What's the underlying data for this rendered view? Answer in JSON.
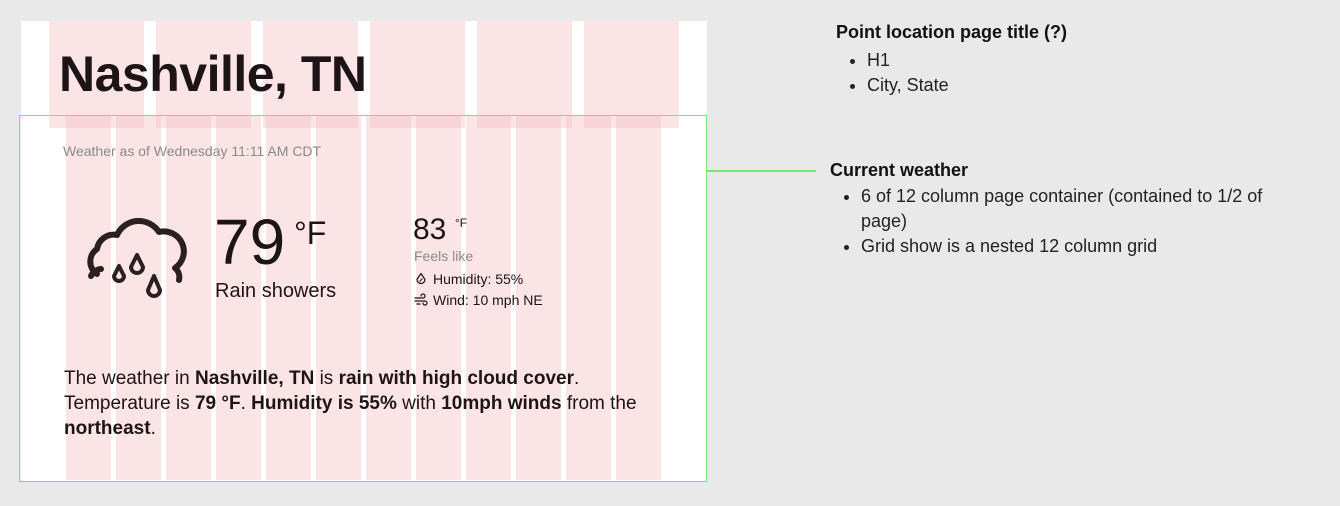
{
  "title": "Nashville, TN",
  "weather": {
    "timestamp": "Weather as of Wednesday 11:11 AM CDT",
    "temperature": "79",
    "temperature_unit": "°F",
    "condition": "Rain showers",
    "feels_like_value": "83",
    "feels_like_unit": "°F",
    "feels_like_label": "Feels like",
    "humidity": "Humidity: 55%",
    "wind": "Wind: 10 mph NE",
    "icon": "rain-cloud-icon"
  },
  "summary": {
    "p1": "The weather in ",
    "b1": "Nashville, TN",
    "p2": " is ",
    "b2": "rain with high cloud cover",
    "p3": ". Temperature is ",
    "b3": "79 °F",
    "p4": ". ",
    "b4": "Humidity is 55%",
    "p5": " with ",
    "b5": "10mph winds",
    "p6": " from the ",
    "b6": "northeast",
    "p7": "."
  },
  "annotations": {
    "page_title_note": {
      "title": "Point location page title (?)",
      "items": [
        "H1",
        "City, State"
      ]
    },
    "current_weather_note": {
      "title": "Current weather",
      "items": [
        "6 of 12 column page container (contained to 1/2 of page)",
        "Grid show is a nested 12 column grid"
      ]
    }
  },
  "colors": {
    "background": "#e9e9e9",
    "card": "#ffffff",
    "grid_column": "#f5bec0",
    "container_outline": "#7de27b",
    "text_dark": "#1c1417",
    "text_muted": "#8a8a8a"
  }
}
